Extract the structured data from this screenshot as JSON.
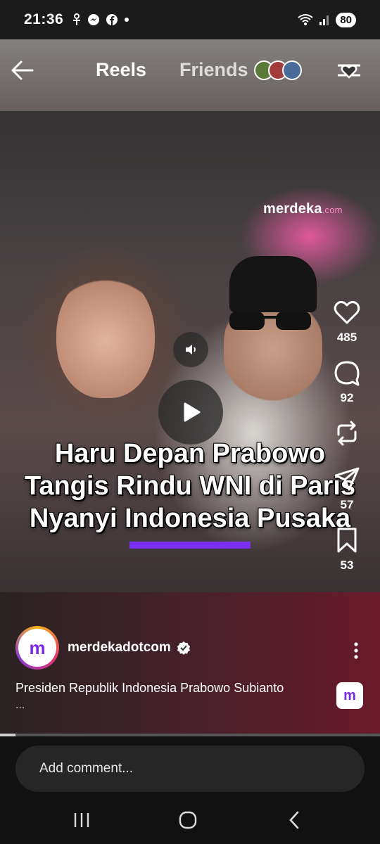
{
  "status_bar": {
    "time": "21:36",
    "notif_icons": [
      "android-debug-icon",
      "messenger-icon",
      "facebook-icon",
      "dot-icon"
    ],
    "battery": "80"
  },
  "header": {
    "tab_reels": "Reels",
    "tab_friends": "Friends"
  },
  "media": {
    "watermark_main": "merdeka",
    "watermark_suffix": ".com",
    "headline_line1": "Haru Depan Prabowo",
    "headline_line2": "Tangis Rindu WNI di Paris",
    "headline_line3": "Nyanyi Indonesia Pusaka",
    "accent_color": "#7a2ff2"
  },
  "actions": {
    "likes": "485",
    "comments": "92",
    "reposts": "",
    "shares": "57",
    "saves": "53"
  },
  "account": {
    "avatar_letter": "m",
    "username": "merdekadotcom",
    "caption": "Presiden Republik Indonesia Prabowo Subianto",
    "caption_more": "...",
    "audio_letter": "m"
  },
  "playback": {
    "progress_fraction": 0.04
  },
  "comment": {
    "placeholder": "Add comment..."
  }
}
